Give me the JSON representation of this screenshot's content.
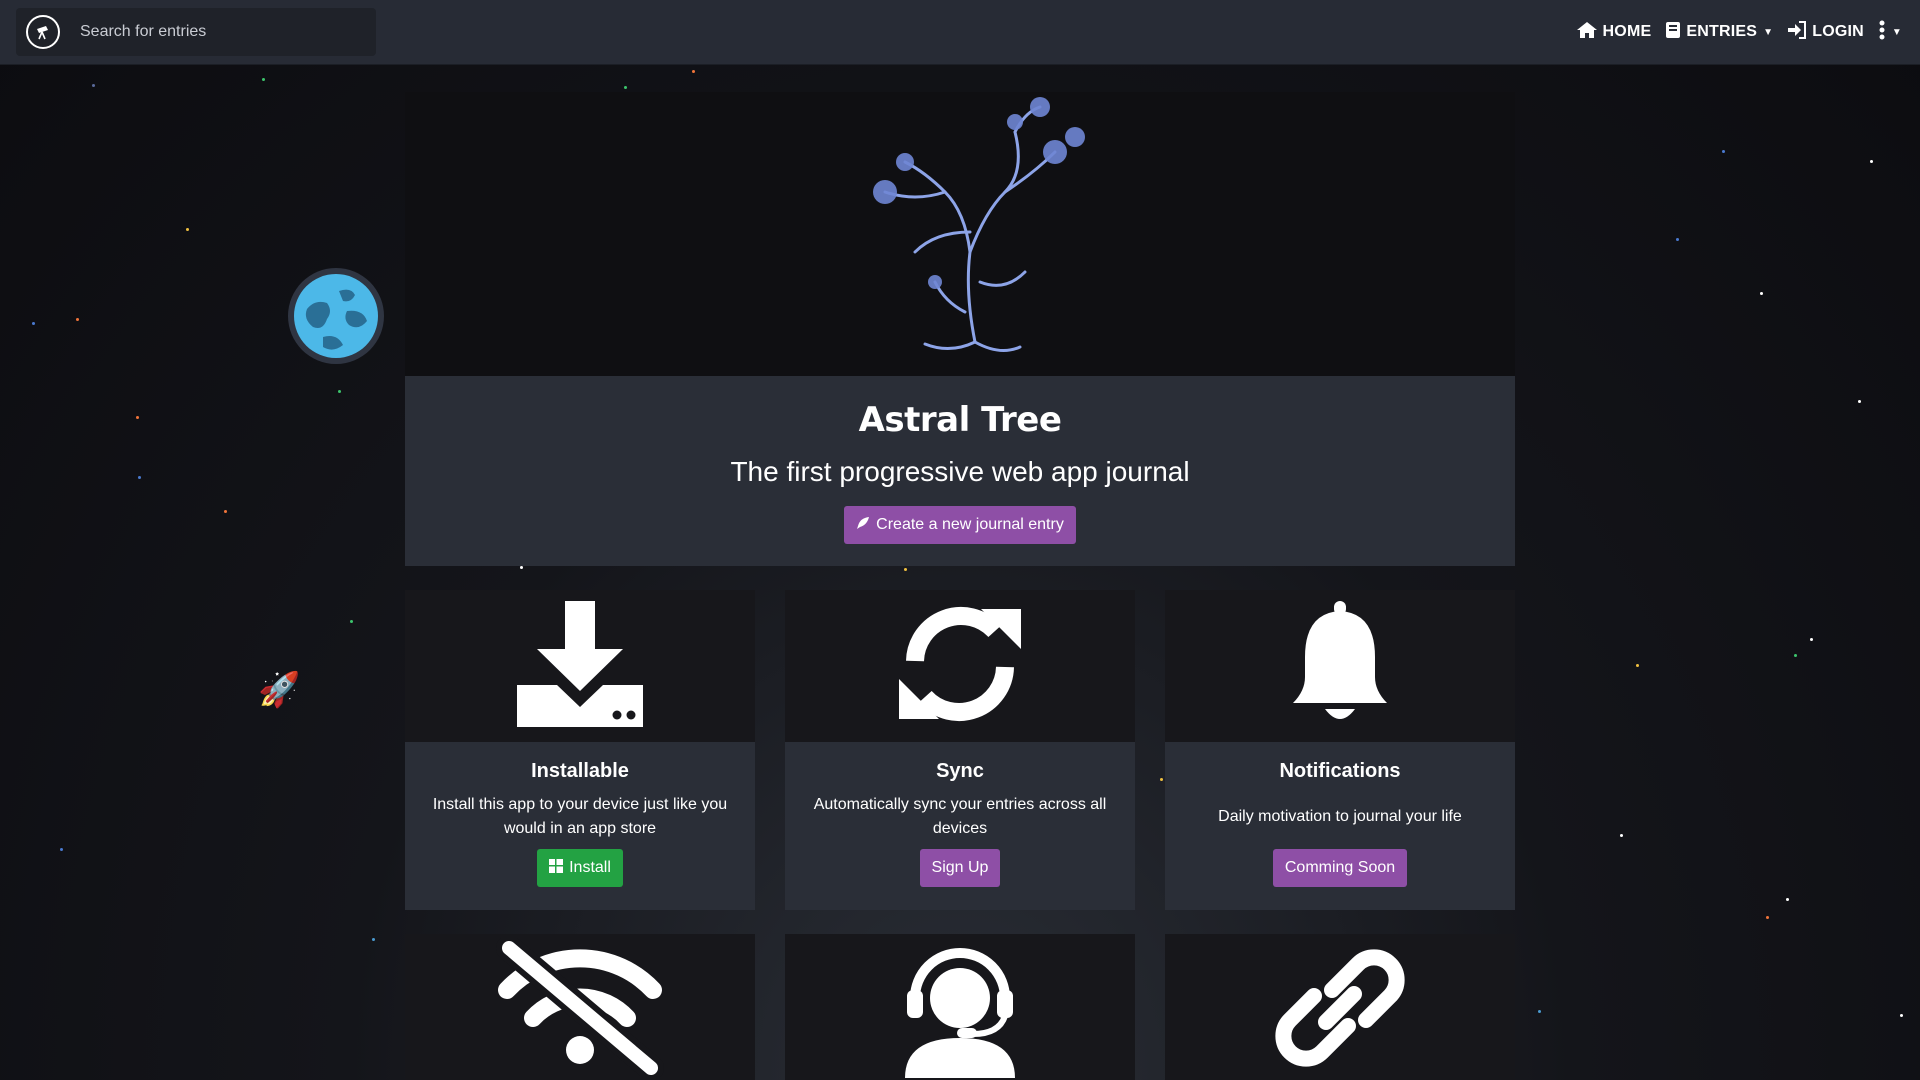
{
  "navbar": {
    "search_placeholder": "Search for entries",
    "brand_icon": "telescope-icon",
    "links": [
      {
        "label": "HOME",
        "icon": "home-icon"
      },
      {
        "label": "ENTRIES",
        "icon": "book-icon"
      },
      {
        "label": "LOGIN",
        "icon": "login-icon"
      }
    ],
    "more_icon": "kebab-menu-icon"
  },
  "hero": {
    "title": "Astral Tree",
    "subtitle": "The first progressive web app journal",
    "cta_label": "Create a new journal entry",
    "cta_icon": "feather-icon"
  },
  "features": [
    {
      "title": "Installable",
      "text": "Install this app to your device just like you would in an app store",
      "button": "Install",
      "icon": "download-icon",
      "button_icon": "windows-icon"
    },
    {
      "title": "Sync",
      "text": "Automatically sync your entries across all devices",
      "button": "Sign Up",
      "icon": "sync-icon"
    },
    {
      "title": "Notifications",
      "text": "Daily motivation to journal your life",
      "button": "Comming Soon",
      "icon": "bell-icon"
    }
  ],
  "more_features": [
    {
      "icon": "wifi-off-icon"
    },
    {
      "icon": "support-agent-icon"
    },
    {
      "icon": "link-icon"
    }
  ],
  "colors": {
    "navbar": "#272b35",
    "panel": "#2a2e37",
    "purple_button": "#8e4fa6",
    "green_button": "#23a243"
  }
}
